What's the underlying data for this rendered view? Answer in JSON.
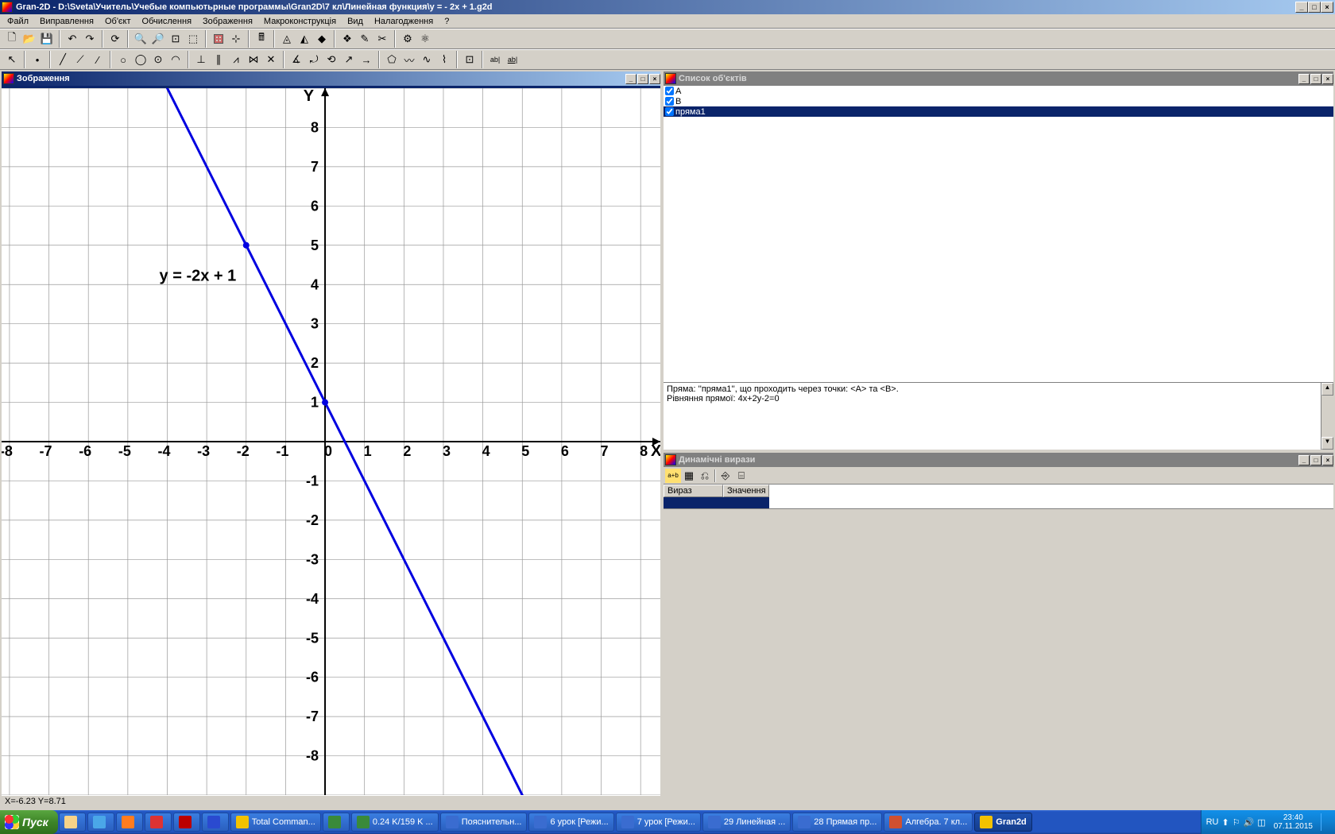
{
  "app": {
    "title": "Gran-2D - D:\\Sveta\\Учитель\\Учебые компьютьрные программы\\Gran2D\\7 кл\\Линейная функция\\y = - 2x + 1.g2d"
  },
  "menu": {
    "items": [
      "Файл",
      "Виправлення",
      "Об'єкт",
      "Обчислення",
      "Зображення",
      "Макроконструкція",
      "Вид",
      "Налагодження",
      "?"
    ]
  },
  "panels": {
    "graph": {
      "title": "Зображення",
      "status": "X=-6.23 Y=8.71"
    },
    "objects": {
      "title": "Список об'єктів",
      "rows": [
        {
          "checked": true,
          "label": "A",
          "sel": false
        },
        {
          "checked": true,
          "label": "B",
          "sel": false
        },
        {
          "checked": true,
          "label": "пряма1",
          "sel": true
        }
      ],
      "info_l1": "Пряма: ''пряма1'', що проходить через точки: <A> та <B>.",
      "info_l2": "Рівняння прямої: 4x+2y-2=0"
    },
    "dynamic": {
      "title": "Динамічні вирази",
      "col1": "Вираз",
      "col2": "Значення"
    }
  },
  "chart_data": {
    "type": "line",
    "title": "",
    "equation_label": "y = -2x + 1",
    "xlabel": "X",
    "ylabel": "Y",
    "xlim": [
      -8.2,
      8.5
    ],
    "ylim": [
      -9,
      9
    ],
    "xticks": [
      -8,
      -7,
      -6,
      -5,
      -4,
      -3,
      -2,
      -1,
      0,
      1,
      2,
      3,
      4,
      5,
      6,
      7,
      8
    ],
    "yticks": [
      -8,
      -7,
      -6,
      -5,
      -4,
      -3,
      -2,
      -1,
      1,
      2,
      3,
      4,
      5,
      6,
      7,
      8
    ],
    "series": [
      {
        "name": "y=-2x+1",
        "points": [
          [
            -4.5,
            10
          ],
          [
            5.5,
            -10
          ]
        ],
        "color": "#0000e0",
        "width": 3
      }
    ],
    "marked_points": [
      {
        "x": -2,
        "y": 5
      },
      {
        "x": 0,
        "y": 1
      }
    ],
    "label_pos": {
      "x": -4.2,
      "y": 4.1
    }
  },
  "taskbar": {
    "start": "Пуск",
    "items": [
      {
        "label": "",
        "icon": "#f7d388"
      },
      {
        "label": "",
        "icon": "#4aa7e8"
      },
      {
        "label": "",
        "icon": "#ff7c1f"
      },
      {
        "label": "",
        "icon": "#d33"
      },
      {
        "label": "",
        "icon": "#b00"
      },
      {
        "label": "",
        "icon": "#2a4ad0"
      },
      {
        "label": "Total Comman...",
        "icon": "#f2c200"
      },
      {
        "label": "",
        "icon": "#3a8a3a"
      },
      {
        "label": "0.24 K/159 K ...",
        "icon": "#3a8a3a"
      },
      {
        "label": "Пояснительн...",
        "icon": "#3a6cd0"
      },
      {
        "label": "6 урок [Режи...",
        "icon": "#3a6cd0"
      },
      {
        "label": "7 урок [Режи...",
        "icon": "#3a6cd0"
      },
      {
        "label": "29 Линейная ...",
        "icon": "#3a6cd0"
      },
      {
        "label": "28 Прямая пр...",
        "icon": "#3a6cd0"
      },
      {
        "label": "Алгебра. 7 кл...",
        "icon": "#d05030"
      },
      {
        "label": "Gran2d",
        "icon": "#f2c200",
        "active": true
      }
    ],
    "tray": {
      "lang": "RU",
      "time": "23:40",
      "date": "07.11.2015"
    }
  }
}
